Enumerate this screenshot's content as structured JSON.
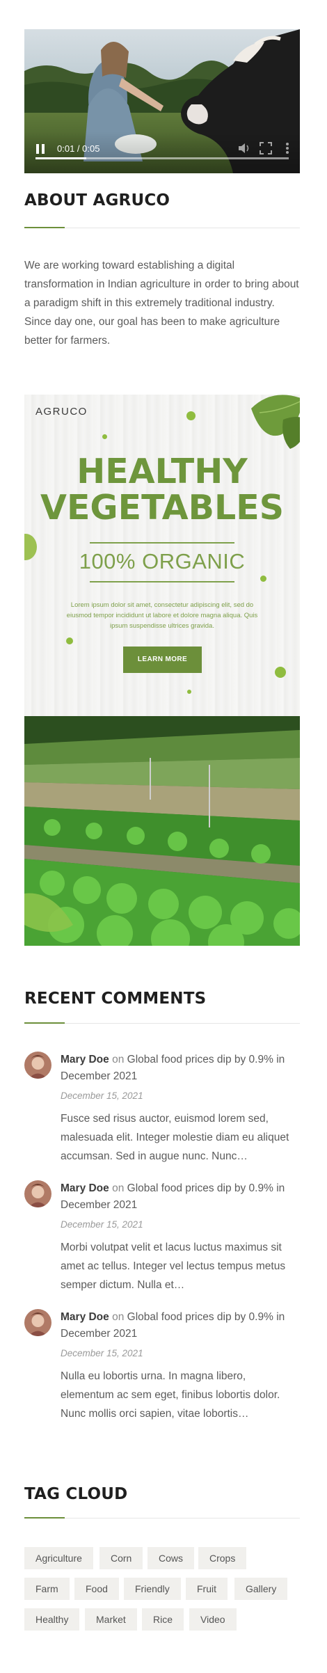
{
  "video": {
    "time": "0:01 / 0:05",
    "progress": 0.2,
    "controls": {
      "play_state_icon": "pause-icon",
      "volume_icon": "speaker-icon",
      "fullscreen_icon": "fullscreen-icon",
      "more_icon": "more-vertical-icon"
    }
  },
  "about": {
    "title": "ABOUT AGRUCO",
    "text": "We are working toward establishing a digital transformation in Indian agriculture in order to bring about a paradigm shift in this extremely traditional industry. Since day one, our goal has been to make agriculture better for farmers."
  },
  "banner": {
    "brand": "AGRUCO",
    "headline_line1": "HEALTHY",
    "headline_line2": "VEGETABLES",
    "subheadline": "100% ORGANIC",
    "body": "Lorem ipsum dolor sit amet, consectetur adipiscing elit, sed do eiusmod tempor incididunt ut labore et dolore magna aliqua. Quis ipsum suspendisse ultrices gravida.",
    "button_label": "LEARN MORE",
    "accent_color": "#6c8f3a"
  },
  "recent_comments": {
    "title": "RECENT COMMENTS",
    "items": [
      {
        "author": "Mary Doe",
        "on": "on",
        "post": "Global food prices dip by 0.9% in December 2021",
        "date": "December 15, 2021",
        "text": "Fusce sed risus auctor, euismod lorem sed, malesuada elit. Integer molestie diam eu aliquet accumsan. Sed in augue nunc. Nunc…"
      },
      {
        "author": "Mary Doe",
        "on": "on",
        "post": "Global food prices dip by 0.9% in December 2021",
        "date": "December 15, 2021",
        "text": "Morbi volutpat velit et lacus luctus maximus sit amet ac tellus. Integer vel lectus tempus metus semper dictum. Nulla et…"
      },
      {
        "author": "Mary Doe",
        "on": "on",
        "post": "Global food prices dip by 0.9% in December 2021",
        "date": "December 15, 2021",
        "text": "Nulla eu lobortis urna. In magna libero, elementum ac sem eget, finibus lobortis dolor. Nunc mollis orci sapien, vitae lobortis…"
      }
    ]
  },
  "tag_cloud": {
    "title": "TAG CLOUD",
    "tags": [
      "Agriculture",
      "Corn",
      "Cows",
      "Crops",
      "Farm",
      "Food",
      "Friendly",
      "Fruit",
      "Gallery",
      "Healthy",
      "Market",
      "Rice",
      "Video"
    ]
  }
}
